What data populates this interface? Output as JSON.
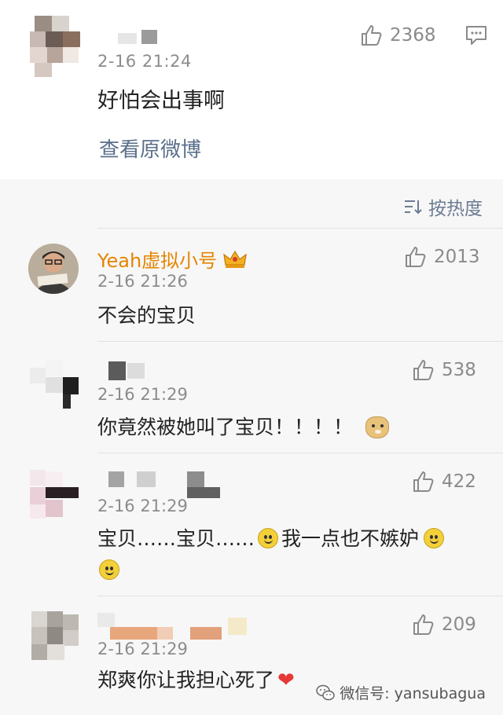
{
  "post": {
    "time": "2-16 21:24",
    "text": "好怕会出事啊",
    "link": "查看原微博",
    "likes": "2368"
  },
  "sort": {
    "label": "按热度"
  },
  "comments": [
    {
      "name": "Yeah虚拟小号",
      "time": "2-16 21:26",
      "text": "不会的宝贝",
      "likes": "2013"
    },
    {
      "time": "2-16 21:29",
      "text": "你竟然被她叫了宝贝！！！！",
      "likes": "538"
    },
    {
      "time": "2-16 21:29",
      "text_a": "宝贝……宝贝……",
      "text_b": "我一点也不嫉妒",
      "likes": "422"
    },
    {
      "time": "2-16 21:29",
      "text": "郑爽你让我担心死了",
      "likes": "209"
    }
  ],
  "watermark": {
    "text": "微信号: yansubagua"
  },
  "colors": {
    "accent_name": "#e58400",
    "link": "#5a6f8a",
    "heart": "#e53935"
  }
}
